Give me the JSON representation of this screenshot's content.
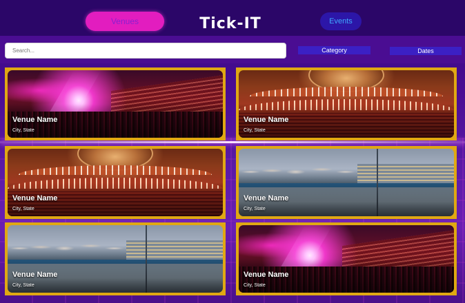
{
  "header": {
    "venues_label": "Venues",
    "title": "Tick-IT",
    "events_label": "Events"
  },
  "search": {
    "placeholder": "Search..."
  },
  "filters": {
    "category_label": "Category",
    "dates_label": "Dates"
  },
  "cards": [
    {
      "name": "Venue Name",
      "location": "City, State",
      "image": "concert"
    },
    {
      "name": "Venue Name",
      "location": "City, State",
      "image": "auditorium"
    },
    {
      "name": "Venue Name",
      "location": "City, State",
      "image": "auditorium"
    },
    {
      "name": "Venue Name",
      "location": "City, State",
      "image": "arena"
    },
    {
      "name": "Venue Name",
      "location": "City, State",
      "image": "arena"
    },
    {
      "name": "Venue Name",
      "location": "City, State",
      "image": "concert"
    }
  ],
  "colors": {
    "venues_button": "#e21dbf",
    "events_button": "#2c16a8",
    "card_border": "#e0a813",
    "filter_button": "#3b20c4"
  }
}
